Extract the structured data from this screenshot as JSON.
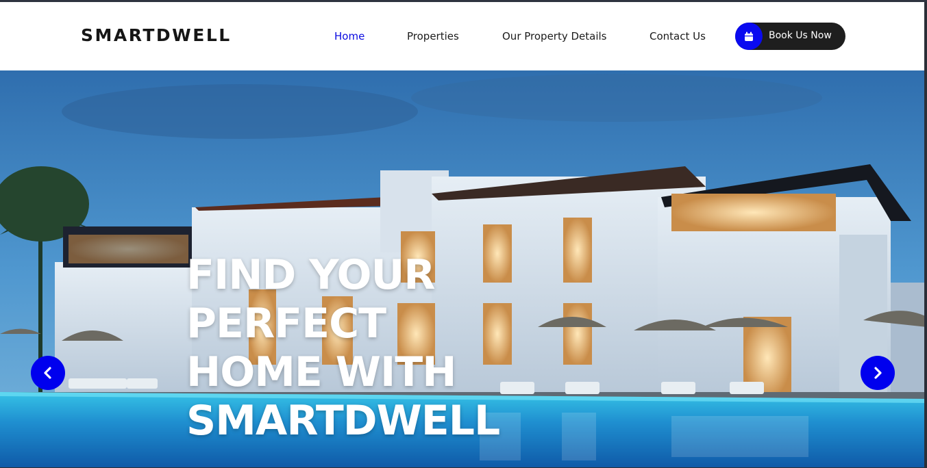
{
  "brand": {
    "name": "SMARTDWELL"
  },
  "nav": {
    "items": [
      {
        "label": "Home",
        "active": true
      },
      {
        "label": "Properties",
        "active": false
      },
      {
        "label": "Our Property Details",
        "active": false
      },
      {
        "label": "Contact Us",
        "active": false
      }
    ],
    "cta": {
      "label": "Book Us Now",
      "icon": "calendar-icon"
    }
  },
  "hero": {
    "title_lines": [
      "FIND YOUR",
      "PERFECT",
      "HOME WITH",
      "SMARTDWELL"
    ],
    "prev_icon": "chevron-left-icon",
    "next_icon": "chevron-right-icon"
  },
  "colors": {
    "accent": "#0a0af0",
    "nav_active": "#0a0ae0",
    "button_bg": "#1e1e1e",
    "text_dark": "#161616"
  }
}
